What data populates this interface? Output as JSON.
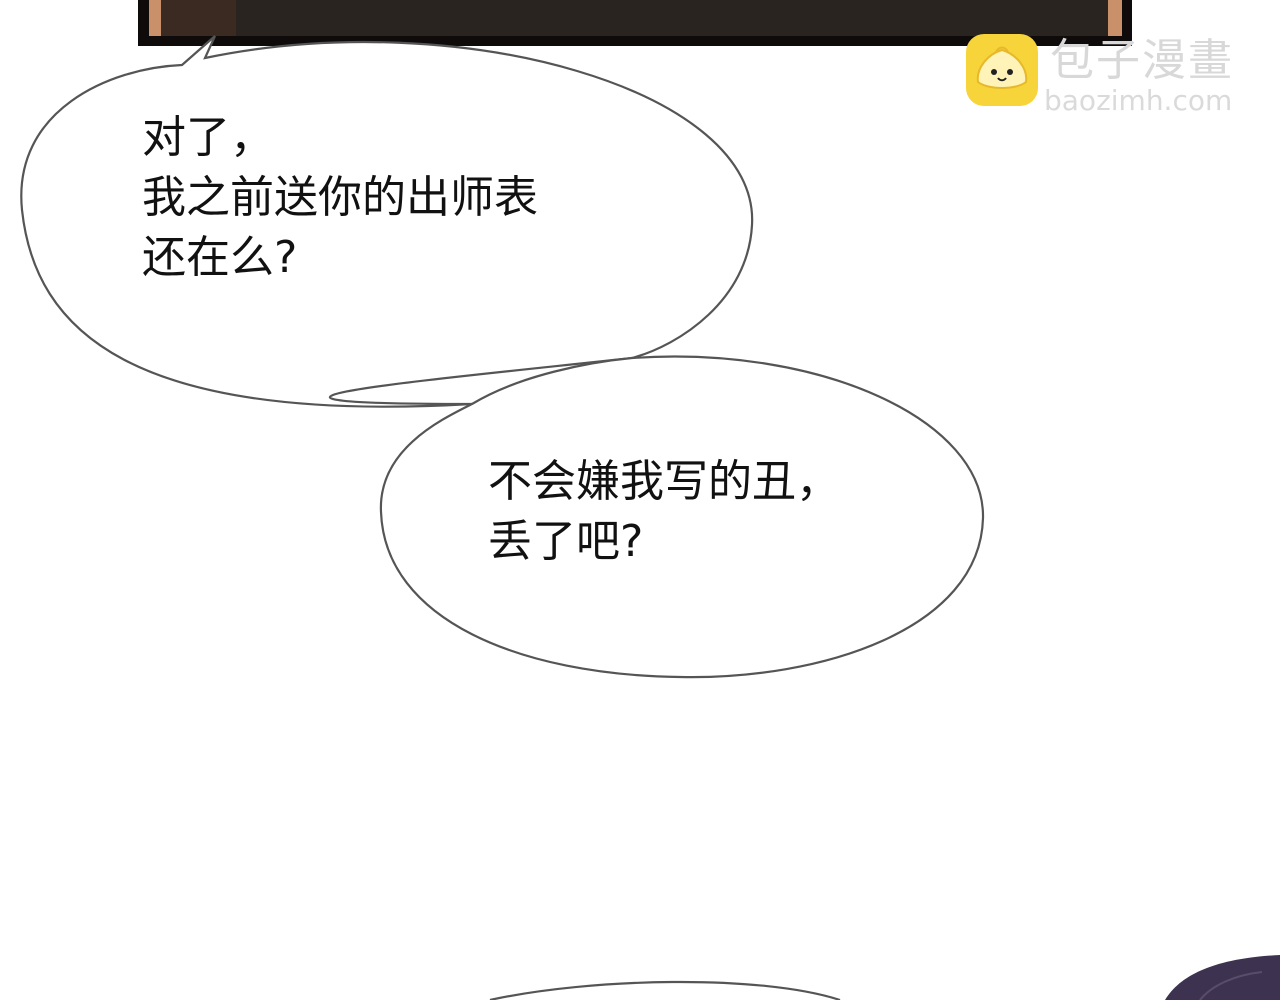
{
  "speech_bubbles": [
    {
      "lines": [
        "对了，",
        "我之前送你的出师表",
        "还在么?"
      ]
    },
    {
      "lines": [
        "不会嫌我写的丑，",
        "丢了吧?"
      ]
    }
  ],
  "watermark": {
    "name": "包子漫畫",
    "url": "baozimh.com",
    "logo_icon": "steamed-bun-icon",
    "logo_color": "#f6d43a"
  },
  "colors": {
    "panel_frame": "#0e0b0a",
    "panel_art": "#2a2420",
    "panel_edge": "#c9906a",
    "bubble_outline": "#555555",
    "text": "#111111",
    "corner_figure": "#3d3350"
  }
}
